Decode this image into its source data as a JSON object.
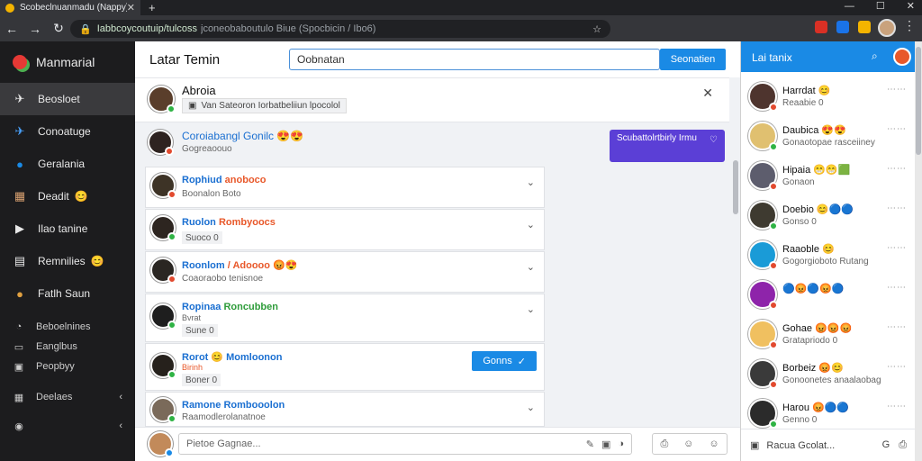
{
  "browser": {
    "tab_title": "Scobeclnuanmadu (Nappy)",
    "tab_close": "✕",
    "new_tab": "+",
    "url_host": "Iabbcoycoutuip/tulcoss",
    "url_path": "jconeobaboutulo Biue (Spocbicin / Ibo6)",
    "window_controls": [
      "—",
      "☐",
      "✕"
    ]
  },
  "brand": {
    "name": "Manmarial"
  },
  "nav": {
    "items": [
      {
        "label": "Beosloet",
        "icon": "✈"
      },
      {
        "label": "Conoatuge",
        "icon": "✈"
      },
      {
        "label": "Geralania",
        "icon": "●"
      },
      {
        "label": "Deadit",
        "icon": "▦"
      },
      {
        "label": "Ilao tanine",
        "icon": "▶"
      },
      {
        "label": "Remnilies",
        "icon": "▤"
      },
      {
        "label": "Fatlh Saun",
        "icon": "●"
      }
    ],
    "small_items": [
      {
        "label": "Beboelnines",
        "icon": "◔"
      },
      {
        "label": "Eanglbus",
        "icon": "▭"
      },
      {
        "label": "Peopbyy",
        "icon": "▣"
      },
      {
        "label": "Deelaes",
        "icon": "▦",
        "chevron": "‹"
      },
      {
        "label": "",
        "icon": "◉",
        "chevron": "‹"
      }
    ]
  },
  "header": {
    "title": "Latar Temin",
    "search_value": "Oobnatan",
    "search_button": "Seonatien"
  },
  "composer": {
    "name": "Abroia",
    "chip": "Van Sateoron Iorbatbeliiun lpocolol",
    "close": "✕"
  },
  "thread": {
    "name": "Coroiabangl Gonilc 😍😍",
    "sub": "Gogreaoouo"
  },
  "bubble": {
    "text": "Scubattolrtbirly Irmu",
    "icon": "♡"
  },
  "cards": [
    {
      "name": "Rophiud",
      "accent": "anoboco",
      "sub": "Boonalon Boto",
      "chip": "",
      "dot": "red"
    },
    {
      "name": "Ruolon",
      "accent": "Rombyoocs",
      "sub": "",
      "chip": "Suoco 0",
      "dot": "green"
    },
    {
      "name": "Roonlom",
      "accent": "/ Adoooo 😡😍",
      "sub": "Coaoraobo tenisnoe",
      "chip": "",
      "dot": "red"
    },
    {
      "name": "Ropinaa",
      "accentg": "Roncubben",
      "sub": "Bvrat",
      "chip": "Sune 0",
      "dot": "green"
    },
    {
      "name": "Rorot",
      "accent2": "😊 Momloonon",
      "sub": "Birinh",
      "chip": "Boner 0",
      "dot": "green",
      "button": "Gonns"
    },
    {
      "name": "Ramone Rombooolon",
      "sub": "Raamodlerolanatnoe",
      "chip": "",
      "dot": "green"
    }
  ],
  "footer": {
    "reply_placeholder": "Pietoe Gagnae...",
    "reply_icons": [
      "✎",
      "▣",
      "◑"
    ],
    "attach_icons": [
      "⎙",
      "☺",
      "☺"
    ]
  },
  "rightpanel": {
    "title": "Lai tanix",
    "contacts": [
      {
        "name": "Harrdat 😊",
        "status": "Reaabie 0",
        "color": "#4e342e",
        "dot": "red"
      },
      {
        "name": "Daubica 😍😍",
        "status": "Gonaotopae rasceiiney",
        "color": "#e0c070",
        "dot": "green"
      },
      {
        "name": "Hipaia 😁😁🟩",
        "status": "Gonaon",
        "color": "#5d5d6d",
        "dot": "red"
      },
      {
        "name": "Doebio 😊🔵🔵",
        "status": "Gonso 0",
        "color": "#3e3a30",
        "dot": "green"
      },
      {
        "name": "Raaoble 😊",
        "status": "Gogorgioboto Rutang",
        "color": "#1a9bd7",
        "dot": "red"
      },
      {
        "name": "🔵😡🔵😡🔵",
        "status": "",
        "color": "#8e24aa",
        "dot": "red"
      },
      {
        "name": "Gohae 😡😡😡",
        "status": "Gratapriodo 0",
        "color": "#f0c060",
        "dot": "red"
      },
      {
        "name": "Borbeiz 😡😊",
        "status": "Gonoonetes anaalaobag",
        "color": "#3a3a3a",
        "dot": "red"
      },
      {
        "name": "Harou 😡🔵🔵",
        "status": "Genno 0",
        "color": "#2b2b2b",
        "dot": "green"
      }
    ],
    "dots": "⋯⋯",
    "footer_label": "Racua Gcolat...",
    "footer_icons": [
      "G",
      "⎙"
    ]
  }
}
